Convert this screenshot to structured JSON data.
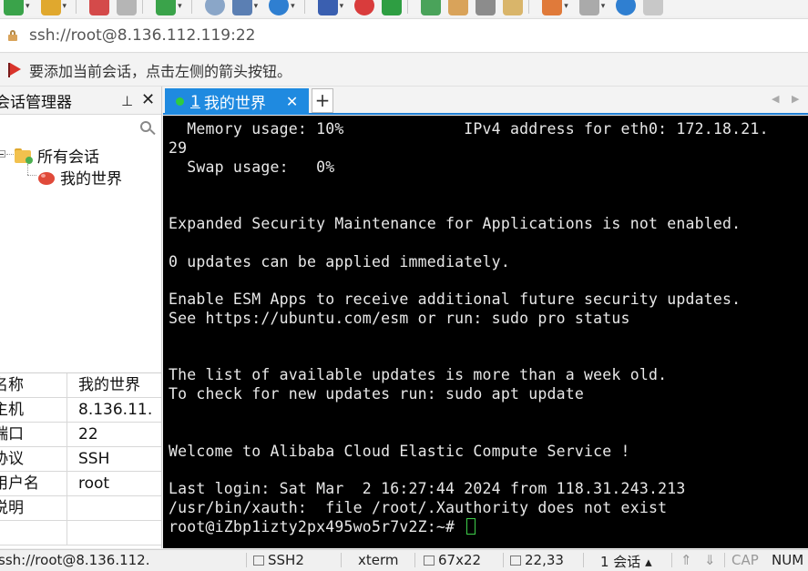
{
  "toolbar": {
    "icons": [
      {
        "name": "new-session-icon",
        "color": "#3aa34a"
      },
      {
        "name": "open-folder-icon",
        "color": "#e0a82e"
      },
      {
        "name": "disconnect-icon",
        "color": "#d44a4a"
      },
      {
        "name": "reconnect-icon",
        "color": "#b5b5b5"
      },
      {
        "name": "settings-gear-icon",
        "color": "#3aa34a"
      },
      {
        "name": "find-icon",
        "color": "#8aa6c8"
      },
      {
        "name": "layout-icon",
        "color": "#5b7fb3"
      },
      {
        "name": "globe-icon",
        "color": "#2f7fd1"
      },
      {
        "name": "font-icon",
        "color": "#3a5fb0"
      },
      {
        "name": "record-icon",
        "color": "#d93c3c"
      },
      {
        "name": "script-icon",
        "color": "#2e9e42"
      },
      {
        "name": "fullscreen-icon",
        "color": "#4aa35a"
      },
      {
        "name": "lock-toolbar-icon",
        "color": "#d9a35a"
      },
      {
        "name": "keyboard-icon",
        "color": "#8c8c8c"
      },
      {
        "name": "highlight-icon",
        "color": "#d9b56a"
      },
      {
        "name": "new-tab-icon",
        "color": "#e07a3a"
      },
      {
        "name": "window-icon",
        "color": "#aaaaaa"
      },
      {
        "name": "help-icon",
        "color": "#2f7fd1"
      },
      {
        "name": "chat-icon",
        "color": "#c8c8c8"
      }
    ]
  },
  "address": {
    "text": "ssh://root@8.136.112.119:22"
  },
  "hint": {
    "text": "要添加当前会话，点击左侧的箭头按钮。"
  },
  "session_panel": {
    "title": "会话管理器",
    "pin": "ᕁ",
    "close": "✕",
    "tree": {
      "root_label": "所有会话",
      "child_label": "我的世界"
    },
    "properties": [
      {
        "key": "名称",
        "value": "我的世界"
      },
      {
        "key": "主机",
        "value": "8.136.11…"
      },
      {
        "key": "端口",
        "value": "22"
      },
      {
        "key": "协议",
        "value": "SSH"
      },
      {
        "key": "用户名",
        "value": "root"
      },
      {
        "key": "说明",
        "value": ""
      },
      {
        "key": "",
        "value": ""
      }
    ]
  },
  "tabs": {
    "active": {
      "number": "1",
      "label": "我的世界",
      "close": "✕"
    },
    "add": "+",
    "nav_left": "◀",
    "nav_right": "▶"
  },
  "terminal": {
    "lines": [
      "  Memory usage: 10%             IPv4 address for eth0: 172.18.21.",
      "29",
      "  Swap usage:   0%",
      "",
      "",
      "Expanded Security Maintenance for Applications is not enabled.",
      "",
      "0 updates can be applied immediately.",
      "",
      "Enable ESM Apps to receive additional future security updates.",
      "See https://ubuntu.com/esm or run: sudo pro status",
      "",
      "",
      "The list of available updates is more than a week old.",
      "To check for new updates run: sudo apt update",
      "",
      "",
      "Welcome to Alibaba Cloud Elastic Compute Service !",
      "",
      "Last login: Sat Mar  2 16:27:44 2024 from 118.31.243.213",
      "/usr/bin/xauth:  file /root/.Xauthority does not exist",
      "root@iZbp1izty2px495wo5r7v2Z:~# "
    ],
    "cursor_color": "#3ecf4a"
  },
  "status": {
    "connection": "ssh://root@8.136.112.",
    "protocol": "SSH2",
    "term": "xterm",
    "size": "67x22",
    "position": "22,33",
    "sessions": "1 会话",
    "cap": "CAP",
    "num": "NUM"
  }
}
